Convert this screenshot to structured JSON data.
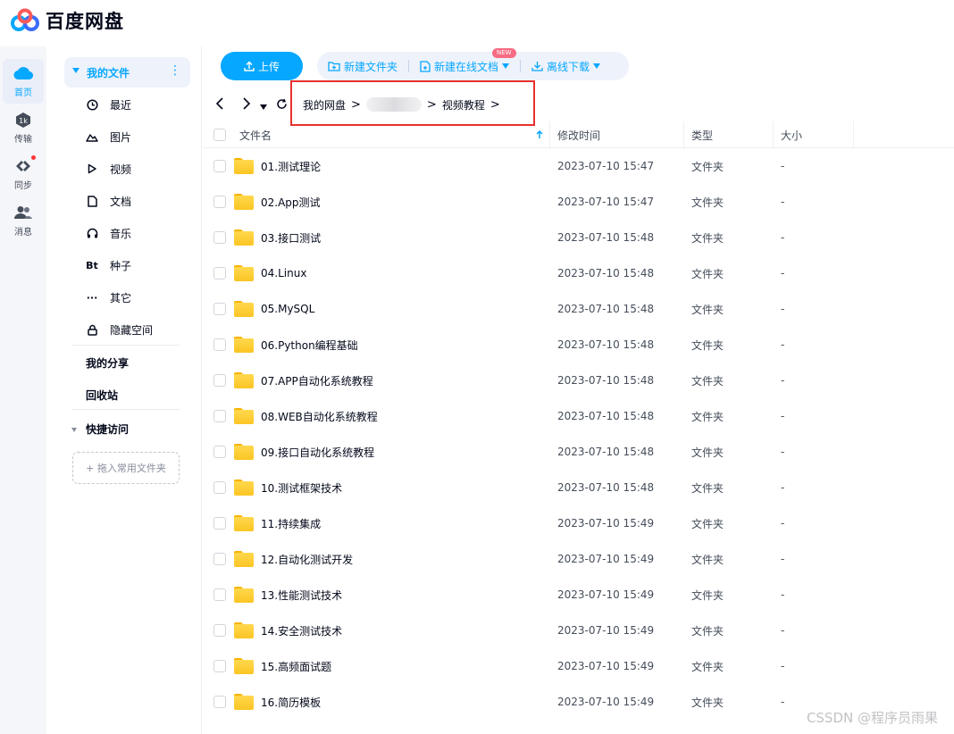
{
  "app": {
    "logo_text": "百度网盘"
  },
  "rail": [
    {
      "label": "首页",
      "icon": "cloud-icon",
      "active": true
    },
    {
      "label": "传输",
      "icon": "transfer-icon"
    },
    {
      "label": "同步",
      "icon": "sync-icon"
    },
    {
      "label": "消息",
      "icon": "message-icon"
    }
  ],
  "sidebar": {
    "section_title": "我的文件",
    "more": "⋮",
    "items": [
      {
        "label": "最近",
        "icon": "clock-icon"
      },
      {
        "label": "图片",
        "icon": "image-icon"
      },
      {
        "label": "视频",
        "icon": "play-icon"
      },
      {
        "label": "文档",
        "icon": "document-icon"
      },
      {
        "label": "音乐",
        "icon": "headphones-icon"
      },
      {
        "label": "种子",
        "icon": "bt-icon"
      },
      {
        "label": "其它",
        "icon": "more-icon"
      },
      {
        "label": "隐藏空间",
        "icon": "lock-icon"
      }
    ],
    "my_share": "我的分享",
    "recycle": "回收站",
    "quick_access": "快捷访问",
    "drag_hint": "+ 拖入常用文件夹"
  },
  "toolbar": {
    "upload": "上传",
    "new_folder": "新建文件夹",
    "new_doc": "新建在线文档",
    "new_badge": "NEW",
    "offline_download": "离线下载"
  },
  "breadcrumb": {
    "root": "我的网盘",
    "current": "视频教程"
  },
  "table": {
    "headers": {
      "name": "文件名",
      "modified": "修改时间",
      "type": "类型",
      "size": "大小"
    },
    "rows": [
      {
        "name": "01.测试理论",
        "modified": "2023-07-10 15:47",
        "type": "文件夹",
        "size": "-"
      },
      {
        "name": "02.App测试",
        "modified": "2023-07-10 15:47",
        "type": "文件夹",
        "size": "-"
      },
      {
        "name": "03.接口测试",
        "modified": "2023-07-10 15:48",
        "type": "文件夹",
        "size": "-"
      },
      {
        "name": "04.Linux",
        "modified": "2023-07-10 15:48",
        "type": "文件夹",
        "size": "-"
      },
      {
        "name": "05.MySQL",
        "modified": "2023-07-10 15:48",
        "type": "文件夹",
        "size": "-"
      },
      {
        "name": "06.Python编程基础",
        "modified": "2023-07-10 15:48",
        "type": "文件夹",
        "size": "-"
      },
      {
        "name": "07.APP自动化系统教程",
        "modified": "2023-07-10 15:48",
        "type": "文件夹",
        "size": "-"
      },
      {
        "name": "08.WEB自动化系统教程",
        "modified": "2023-07-10 15:48",
        "type": "文件夹",
        "size": "-"
      },
      {
        "name": "09.接口自动化系统教程",
        "modified": "2023-07-10 15:48",
        "type": "文件夹",
        "size": "-"
      },
      {
        "name": "10.测试框架技术",
        "modified": "2023-07-10 15:48",
        "type": "文件夹",
        "size": "-"
      },
      {
        "name": "11.持续集成",
        "modified": "2023-07-10 15:49",
        "type": "文件夹",
        "size": "-"
      },
      {
        "name": "12.自动化测试开发",
        "modified": "2023-07-10 15:49",
        "type": "文件夹",
        "size": "-"
      },
      {
        "name": "13.性能测试技术",
        "modified": "2023-07-10 15:49",
        "type": "文件夹",
        "size": "-"
      },
      {
        "name": "14.安全测试技术",
        "modified": "2023-07-10 15:49",
        "type": "文件夹",
        "size": "-"
      },
      {
        "name": "15.高频面试题",
        "modified": "2023-07-10 15:49",
        "type": "文件夹",
        "size": "-"
      },
      {
        "name": "16.简历模板",
        "modified": "2023-07-10 15:49",
        "type": "文件夹",
        "size": "-"
      }
    ]
  },
  "watermark": "CSSDN @程序员雨果",
  "colors": {
    "accent": "#06a7ff",
    "highlight_box": "#e8312d",
    "folder": "#fbc524"
  }
}
